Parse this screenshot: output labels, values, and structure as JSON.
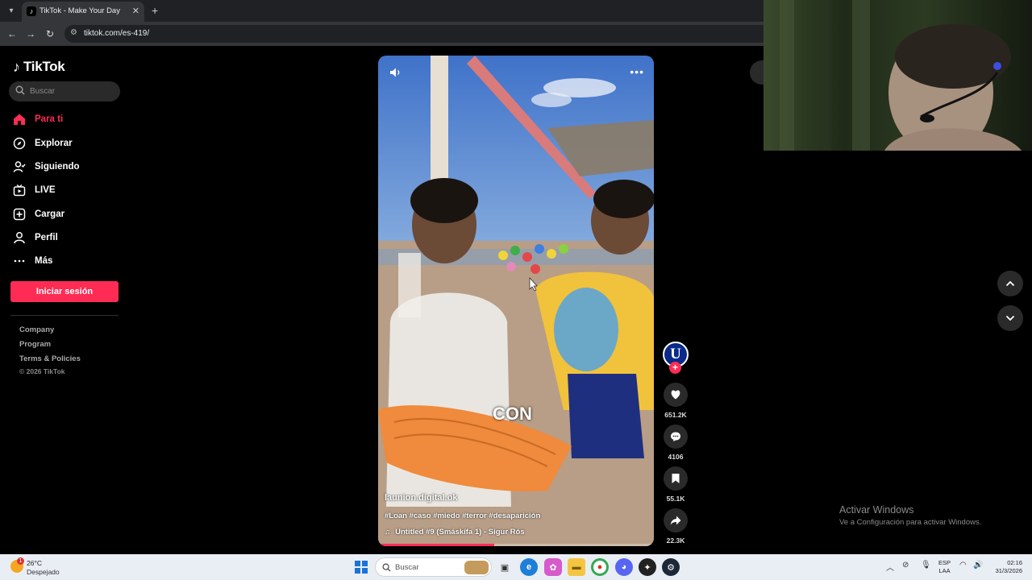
{
  "browser": {
    "tab_title": "TikTok - Make Your Day",
    "url": "tiktok.com/es-419/"
  },
  "sidebar": {
    "logo_text": "TikTok",
    "search_placeholder": "Buscar",
    "nav": [
      {
        "label": "Para ti",
        "icon": "home-icon",
        "active": true
      },
      {
        "label": "Explorar",
        "icon": "compass-icon"
      },
      {
        "label": "Siguiendo",
        "icon": "following-icon"
      },
      {
        "label": "LIVE",
        "icon": "live-icon"
      },
      {
        "label": "Cargar",
        "icon": "upload-icon"
      },
      {
        "label": "Perfil",
        "icon": "profile-icon"
      },
      {
        "label": "Más",
        "icon": "more-icon"
      }
    ],
    "login_label": "Iniciar sesión",
    "footer_links": [
      "Company",
      "Program",
      "Terms & Policies"
    ],
    "copyright": "© 2026 TikTok"
  },
  "video": {
    "overlay_caption": "CON",
    "author": "launion.digital.ok",
    "hashtags": "#Loan #caso #miedo #terror #desaparición",
    "music": "Untitled #9 (Smáskífa 1) - Sigur Rós",
    "progress": 0.42
  },
  "actions": {
    "avatar_letter": "U",
    "likes": "651.2K",
    "comments": "4106",
    "saves": "55.1K",
    "shares": "22.3K"
  },
  "watermark": {
    "title": "Activar Windows",
    "subtitle": "Ve a Configuración para activar Windows."
  },
  "taskbar": {
    "temperature": "26°C",
    "weather": "Despejado",
    "weather_badge": "1",
    "search_label": "Buscar",
    "lang_top": "ESP",
    "lang_bottom": "LAA",
    "time": "02:16",
    "date": "31/3/2026"
  },
  "colors": {
    "accent": "#fe2c55",
    "background": "#000000",
    "chrome": "#35363a"
  }
}
